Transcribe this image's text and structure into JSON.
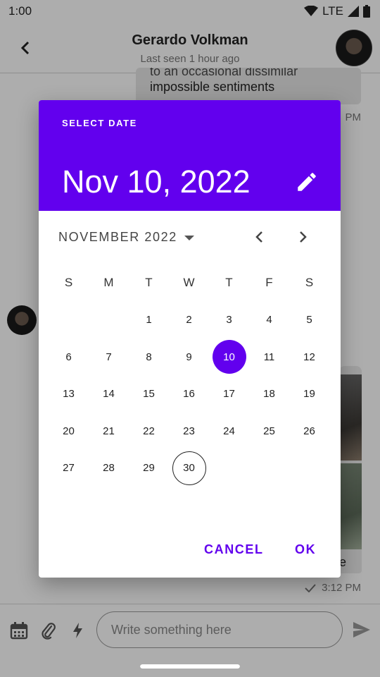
{
  "status_bar": {
    "time": "1:00",
    "network": "LTE"
  },
  "chat": {
    "contact_name": "Gerardo Volkman",
    "last_seen": "Last seen 1 hour ago",
    "message_partial_line": "to an occasional dissimilar",
    "message_line": "impossible sentiments",
    "message_time_fragment": "PM",
    "image_caption_fragment": "e",
    "image_time": "3:12 PM"
  },
  "composer": {
    "placeholder": "Write something here",
    "icons": [
      "calendar-icon",
      "paperclip-icon",
      "bolt-icon",
      "send-icon"
    ]
  },
  "date_picker": {
    "label": "SELECT DATE",
    "selected_date_text": "Nov 10, 2022",
    "month_label": "NOVEMBER 2022",
    "weekdays": [
      "S",
      "M",
      "T",
      "W",
      "T",
      "F",
      "S"
    ],
    "weeks": [
      [
        "",
        "",
        "1",
        "2",
        "3",
        "4",
        "5"
      ],
      [
        "6",
        "7",
        "8",
        "9",
        "10",
        "11",
        "12"
      ],
      [
        "13",
        "14",
        "15",
        "16",
        "17",
        "18",
        "19"
      ],
      [
        "20",
        "21",
        "22",
        "23",
        "24",
        "25",
        "26"
      ],
      [
        "27",
        "28",
        "29",
        "30",
        "",
        "",
        ""
      ]
    ],
    "selected_day": "10",
    "today_day": "30",
    "cancel_label": "CANCEL",
    "ok_label": "OK",
    "accent_color": "#6200ee"
  }
}
